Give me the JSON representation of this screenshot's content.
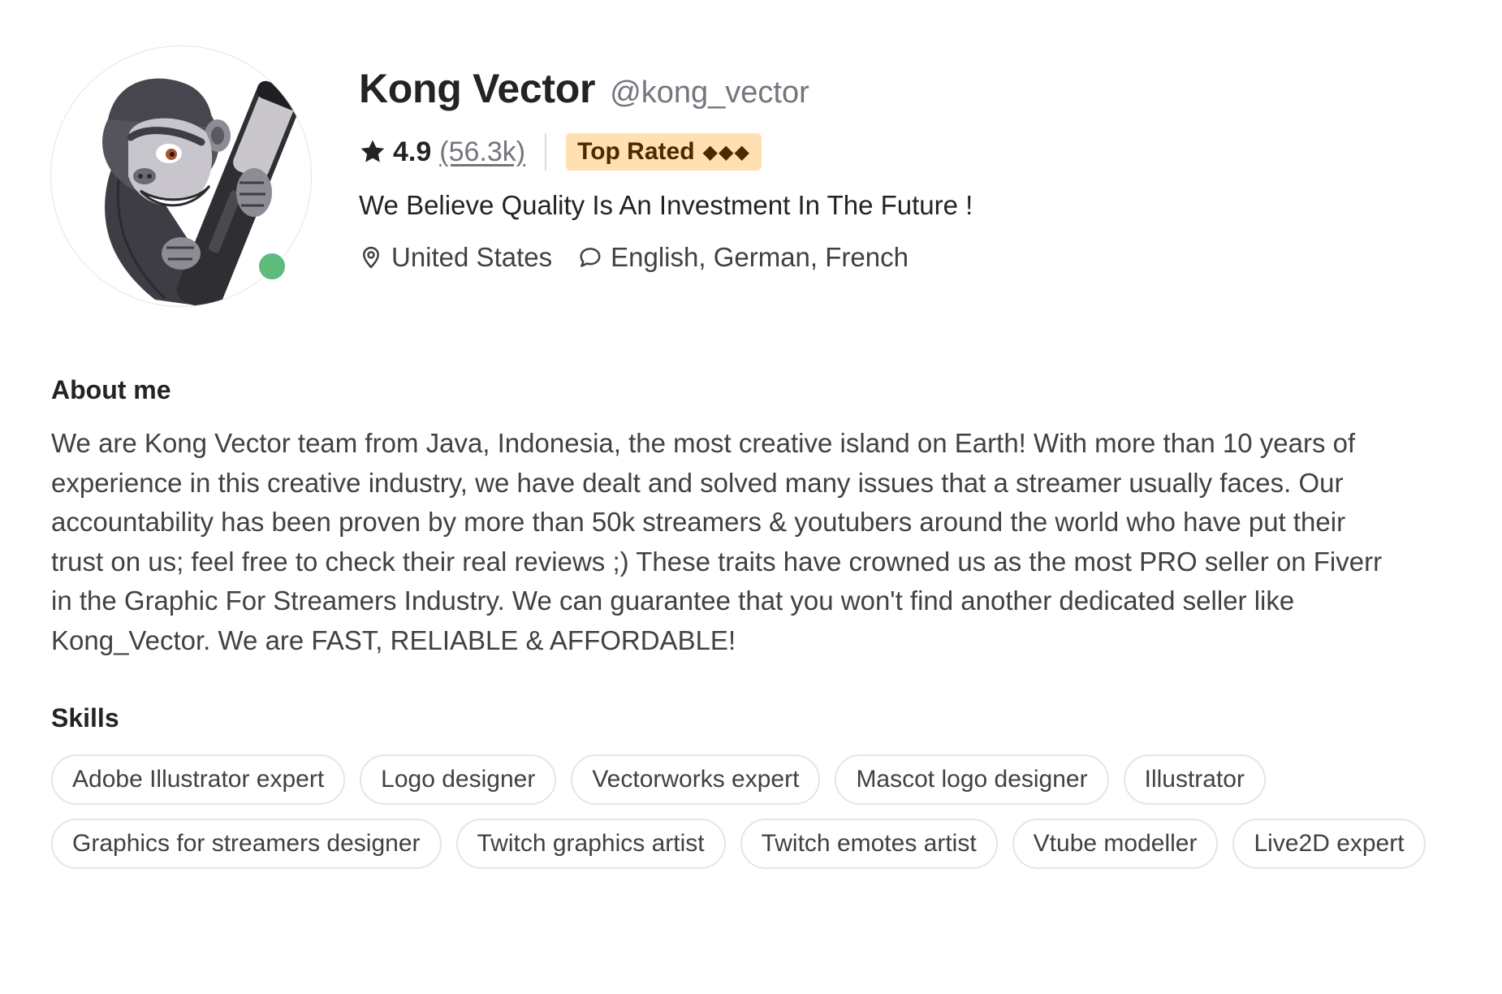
{
  "profile": {
    "display_name": "Kong Vector",
    "username": "@kong_vector",
    "online": true,
    "avatar_icon": "gorilla-mascot-avatar",
    "online_color": "#5fbb7b",
    "rating": {
      "score": "4.9",
      "count": "(56.3k)",
      "icon": "star-icon"
    },
    "badge": {
      "label": "Top Rated",
      "diamonds": "◆◆◆",
      "background": "#ffe0b3",
      "color": "#4d2900"
    },
    "tagline": "We Believe Quality Is An Investment In The Future !",
    "location": {
      "icon": "location-pin-icon",
      "label": "United States"
    },
    "languages": {
      "icon": "speech-bubble-icon",
      "label": "English, German, French"
    }
  },
  "about": {
    "title": "About me",
    "text": "We are Kong Vector team from Java, Indonesia, the most creative island on Earth! With more than 10 years of experience in this creative industry, we have dealt and solved many issues that a streamer usually faces. Our accountability has been proven by more than 50k streamers & youtubers around the world who have put their trust on us; feel free to check their real reviews ;) These traits have crowned us as the most PRO seller on Fiverr in the Graphic For Streamers Industry. We can guarantee that you won't find another dedicated seller like Kong_Vector. We are FAST, RELIABLE & AFFORDABLE!"
  },
  "skills": {
    "title": "Skills",
    "items": [
      "Adobe Illustrator expert",
      "Logo designer",
      "Vectorworks expert",
      "Mascot logo designer",
      "Illustrator",
      "Graphics for streamers designer",
      "Twitch graphics artist",
      "Twitch emotes artist",
      "Vtube modeller",
      "Live2D expert"
    ]
  }
}
